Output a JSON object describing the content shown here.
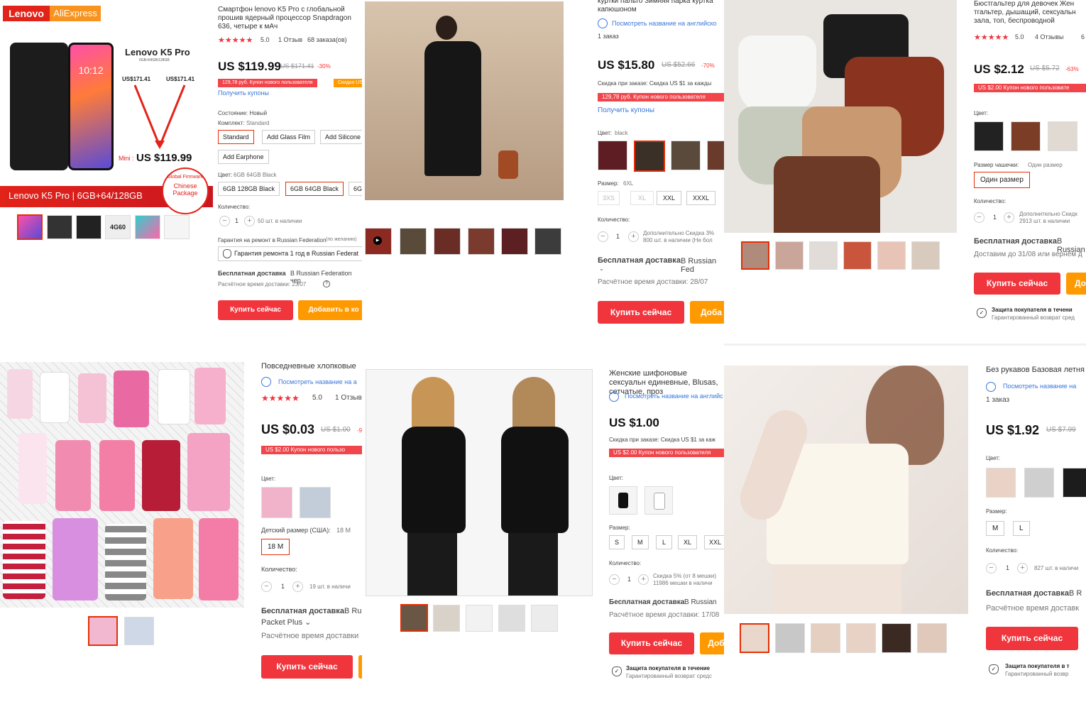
{
  "p1": {
    "brand_logo": "Lenovo",
    "store_logo": "AliExpress",
    "ad_model": "Lenovo K5 Pro",
    "ad_spec": "6GB+64GB/128GB",
    "old_price_left": "US$171.41",
    "old_price_right": "US$171.41",
    "mini_label": "Mini :",
    "ad_price": "US $119.99",
    "banner": "Lenovo K5 Pro | 6GB+64/128GB",
    "badge_1": "Global Firmware",
    "badge_2": "Chinese",
    "badge_3": "Package",
    "phone_time": "10:12",
    "thumb_label": "4G60",
    "title": "Смартфон lenovo K5 Pro с глобальной прошив ядерный процессор Snapdragon 636, четыре к мАч",
    "rating": "5.0",
    "reviews": "1 Отзыв",
    "orders": "68 заказа(ов)",
    "price": "US $119.99",
    "old_price": "US $171.41",
    "discount": "-30%",
    "coupon": "129,78 руб. Купон нового пользователя",
    "coupon2": "Скидка US",
    "get_coupons": "Получить купоны",
    "condition_label": "Состояние: Новый",
    "kit_label": "Комплект:",
    "kit_value": "Standard",
    "kit_options": [
      "Standard",
      "Add Glass Film",
      "Add Silicone",
      "Add Earphone"
    ],
    "color_label": "Цвет:",
    "color_value": "6GB 64GB Black",
    "color_options": [
      "6GB 128GB Black",
      "6GB 64GB Black",
      "6G"
    ],
    "qty_label": "Количество:",
    "qty": "1",
    "stock": "50 шт. в наличии",
    "warranty_label": "Гарантия на ремонт в Russian Federation",
    "warranty_note": "(по желанию)",
    "warranty_option": "Гарантия ремонта 1 год в Russian Federat",
    "shipping_bold": "Бесплатная доставка",
    "shipping_rest": "В Russian Federation чер",
    "delivery": "Расчётное время доставки: 23/07",
    "buy": "Купить сейчас",
    "add_cart": "Добавить в ко"
  },
  "p2": {
    "title": "куртки пальто Зимняя парка куртка капюшоном",
    "see_title": "Посмотреть название на английско",
    "orders": "1 заказ",
    "price": "US $15.80",
    "old_price": "US $52.66",
    "discount": "-70%",
    "discount_note": "Скидка при заказе: Скидка US $1 за кажды",
    "coupon": "129,78 руб. Купон нового пользователя",
    "get_coupons": "Получить купоны",
    "color_label": "Цвет:",
    "color_value": "black",
    "size_label": "Размер:",
    "size_value": "6XL",
    "sizes": [
      "3XS",
      "XL",
      "XXL",
      "XXXL"
    ],
    "qty_label": "Количество:",
    "qty": "1",
    "stock_note": "Дополнительно Скидка 3% 800 шт. в наличии (Не бол",
    "shipping_bold": "Бесплатная доставка",
    "shipping_rest": "В Russian Fed",
    "delivery": "Расчётное время доставки: 28/07",
    "buy": "Купить сейчас",
    "add_cart": "Доба"
  },
  "p3": {
    "title": "Бюстгальтер для девочек Жен тгальтер, дышащий, сексуальн зала, топ, беспроводной",
    "rating": "5.0",
    "reviews": "4 Отзывы",
    "reviews_extra": "6",
    "price": "US $2.12",
    "old_price": "US $5.72",
    "discount": "-63%",
    "coupon": "US $2.00 Купон нового пользовате",
    "color_label": "Цвет:",
    "cup_label": "Размер чашечки:",
    "cup_value": "Один размер",
    "cup_option": "Один размер",
    "qty_label": "Количество:",
    "qty": "1",
    "stock_note": "Дополнительно Скидк 2913 шт. в наличии",
    "shipping_bold": "Бесплатная доставка",
    "shipping_rest": "В Russian",
    "delivery": "Доставим до 31/08 или вернём д",
    "buy": "Купить сейчас",
    "add_cart": "До",
    "protect": "Защита покупателя в течени",
    "protect_sub": "Гарантированный возврат сред"
  },
  "p4": {
    "title": "Повседневные хлопковые",
    "see_title": "Посмотреть название на а",
    "rating": "5.0",
    "reviews": "1 Отзыв",
    "price": "US $0.03",
    "old_price": "US $1.00",
    "discount": "-9",
    "coupon": "US $2.00 Купон нового пользо",
    "color_label": "Цвет:",
    "size_label": "Детский размер (США):",
    "size_value": "18 M",
    "size_option": "18 M",
    "qty_label": "Количество:",
    "qty": "1",
    "stock": "19 шт. в наличи",
    "shipping_bold": "Бесплатная доставка",
    "shipping_rest": "В Ru",
    "shipping_line2": "Packet Plus",
    "delivery": "Расчётное время доставки",
    "buy": "Купить сейчас"
  },
  "p5": {
    "title": "Женские шифоновые сексуальн единевные, Blusas, сетчатые, проз",
    "see_title": "Посмотреть название на английс",
    "price": "US $1.00",
    "discount_note": "Скидка при заказе: Скидка US $1 за каж",
    "coupon": "US $2.00 Купон нового пользователя",
    "color_label": "Цвет:",
    "size_label": "Размер:",
    "sizes": [
      "S",
      "M",
      "L",
      "XL",
      "XXL"
    ],
    "qty_label": "Количество:",
    "qty": "1",
    "stock_note": "Скидка 5% (от 8 мешки) 11986 мешки в наличи",
    "shipping_bold": "Бесплатная доставка",
    "shipping_rest": "В Russian",
    "delivery": "Расчётное время доставки: 17/08",
    "buy": "Купить сейчас",
    "add_cart": "Доб",
    "protect": "Защита покупателя в течение",
    "protect_sub": "Гарантированный возврат средс"
  },
  "p6": {
    "title": "Без рукавов Базовая летня",
    "see_title": "Посмотреть название на",
    "orders": "1 заказ",
    "price": "US $1.92",
    "old_price": "US $7.99",
    "color_label": "Цвет:",
    "size_label": "Размер:",
    "sizes": [
      "M",
      "L"
    ],
    "qty_label": "Количество:",
    "qty": "1",
    "stock": "827 шт. в наличи",
    "shipping_bold": "Бесплатная доставка",
    "shipping_rest": "В R",
    "delivery": "Расчётное время доставк",
    "buy": "Купить сейчас",
    "protect": "Защита покупателя в т",
    "protect_sub": "Гарантированный возвр"
  },
  "colors": {
    "accent_red": "#f0353d",
    "accent_orange": "#ff9900",
    "link_blue": "#3a77d9",
    "lenovo_red": "#e2231a"
  }
}
